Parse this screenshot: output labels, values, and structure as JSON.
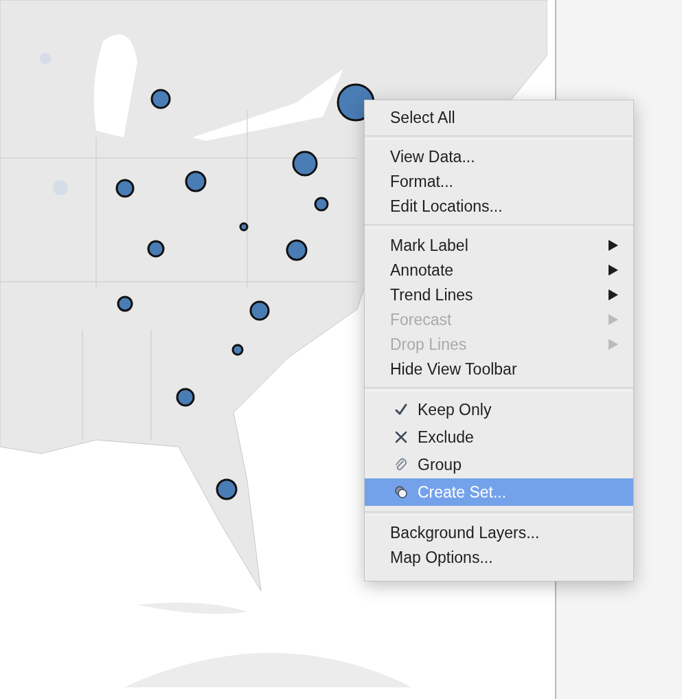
{
  "context_menu": {
    "sections": [
      {
        "items": [
          {
            "label": "Select All",
            "kind": "plain",
            "disabled": false,
            "selected": false
          }
        ]
      },
      {
        "items": [
          {
            "label": "View Data...",
            "kind": "plain",
            "disabled": false,
            "selected": false
          },
          {
            "label": "Format...",
            "kind": "plain",
            "disabled": false,
            "selected": false
          },
          {
            "label": "Edit Locations...",
            "kind": "plain",
            "disabled": false,
            "selected": false
          }
        ]
      },
      {
        "items": [
          {
            "label": "Mark Label",
            "kind": "submenu",
            "disabled": false,
            "selected": false
          },
          {
            "label": "Annotate",
            "kind": "submenu",
            "disabled": false,
            "selected": false
          },
          {
            "label": "Trend Lines",
            "kind": "submenu",
            "disabled": false,
            "selected": false
          },
          {
            "label": "Forecast",
            "kind": "submenu",
            "disabled": true,
            "selected": false
          },
          {
            "label": "Drop Lines",
            "kind": "submenu",
            "disabled": true,
            "selected": false
          },
          {
            "label": "Hide View Toolbar",
            "kind": "plain",
            "disabled": false,
            "selected": false
          }
        ]
      },
      {
        "items": [
          {
            "label": "Keep Only",
            "kind": "icon",
            "disabled": false,
            "selected": false
          },
          {
            "label": "Exclude",
            "kind": "icon",
            "disabled": false,
            "selected": false
          },
          {
            "label": "Group",
            "kind": "icon",
            "disabled": false,
            "selected": false
          },
          {
            "label": "Create Set...",
            "kind": "icon",
            "disabled": false,
            "selected": true
          }
        ]
      },
      {
        "items": [
          {
            "label": "Background Layers...",
            "kind": "plain",
            "disabled": false,
            "selected": false
          },
          {
            "label": "Map Options...",
            "kind": "plain",
            "disabled": false,
            "selected": false
          }
        ]
      }
    ]
  }
}
